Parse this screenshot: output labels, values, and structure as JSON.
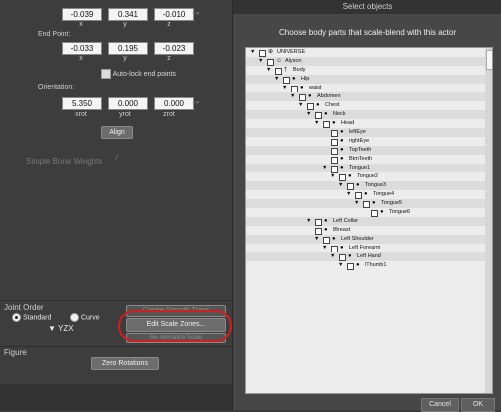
{
  "left": {
    "top_values": [
      "-0.039",
      "0.341",
      "-0.010"
    ],
    "top_axes": [
      "x",
      "y",
      "z"
    ],
    "end_point_label": "End Point:",
    "end_values": [
      "-0.033",
      "0.195",
      "-0.023"
    ],
    "end_axes": [
      "x",
      "y",
      "z"
    ],
    "auto_lock_label": "Auto-lock end points",
    "orientation_label": "Orientation:",
    "orient_values": [
      "5.350",
      "0.000",
      "0.000"
    ],
    "orient_axes": [
      "xrot",
      "yrot",
      "zrot"
    ],
    "align_label": "Align",
    "simple_bone_weights": "Simple Bone Weights",
    "joint_order_label": "Joint Order",
    "standard_label": "Standard",
    "curve_label": "Curve",
    "order_value": "YZX",
    "create_smooth_trans": "Create Smooth Trans",
    "edit_scale_zones": "Edit Scale Zones...",
    "re_normalize_scale": "Re-normalize Scale",
    "figure_label": "Figure",
    "zero_rotations": "Zero Rotations"
  },
  "dialog": {
    "title": "Select objects",
    "instruction": "Choose body parts that scale-blend with this actor",
    "cancel": "Cancel",
    "ok": "OK",
    "tree": [
      {
        "name": "UNIVERSE",
        "depth": 0,
        "icon": "globe-icon"
      },
      {
        "name": "Alyson",
        "depth": 1,
        "icon": "figure-icon"
      },
      {
        "name": "Body",
        "depth": 2,
        "icon": "body-icon"
      },
      {
        "name": "Hip",
        "depth": 3,
        "icon": "bone-icon"
      },
      {
        "name": "waist",
        "depth": 4,
        "icon": "bone-icon"
      },
      {
        "name": "Abdomen",
        "depth": 5,
        "icon": "bone-icon"
      },
      {
        "name": "Chest",
        "depth": 6,
        "icon": "bone-icon"
      },
      {
        "name": "Neck",
        "depth": 7,
        "icon": "bone-icon"
      },
      {
        "name": "Head",
        "depth": 8,
        "icon": "bone-icon"
      },
      {
        "name": "leftEye",
        "depth": 9,
        "icon": "bone-icon",
        "leaf": true
      },
      {
        "name": "rightEye",
        "depth": 9,
        "icon": "bone-icon",
        "leaf": true
      },
      {
        "name": "TopTeeth",
        "depth": 9,
        "icon": "bone-icon",
        "leaf": true
      },
      {
        "name": "BtmTeeth",
        "depth": 9,
        "icon": "bone-icon",
        "leaf": true
      },
      {
        "name": "Tongue1",
        "depth": 9,
        "icon": "bone-icon"
      },
      {
        "name": "Tongue2",
        "depth": 10,
        "icon": "bone-icon"
      },
      {
        "name": "Tongue3",
        "depth": 11,
        "icon": "bone-icon"
      },
      {
        "name": "Tongue4",
        "depth": 12,
        "icon": "bone-icon"
      },
      {
        "name": "Tongue5",
        "depth": 13,
        "icon": "bone-icon"
      },
      {
        "name": "Tongue6",
        "depth": 14,
        "icon": "bone-icon",
        "leaf": true
      },
      {
        "name": "Left Collar",
        "depth": 7,
        "icon": "bone-icon"
      },
      {
        "name": "lBreast",
        "depth": 7,
        "icon": "bone-icon",
        "leaf": true
      },
      {
        "name": "Left Shoulder",
        "depth": 8,
        "icon": "bone-icon"
      },
      {
        "name": "Left Forearm",
        "depth": 9,
        "icon": "bone-icon"
      },
      {
        "name": "Left Hand",
        "depth": 10,
        "icon": "bone-icon"
      },
      {
        "name": "lThumb1",
        "depth": 11,
        "icon": "bone-icon"
      }
    ]
  }
}
